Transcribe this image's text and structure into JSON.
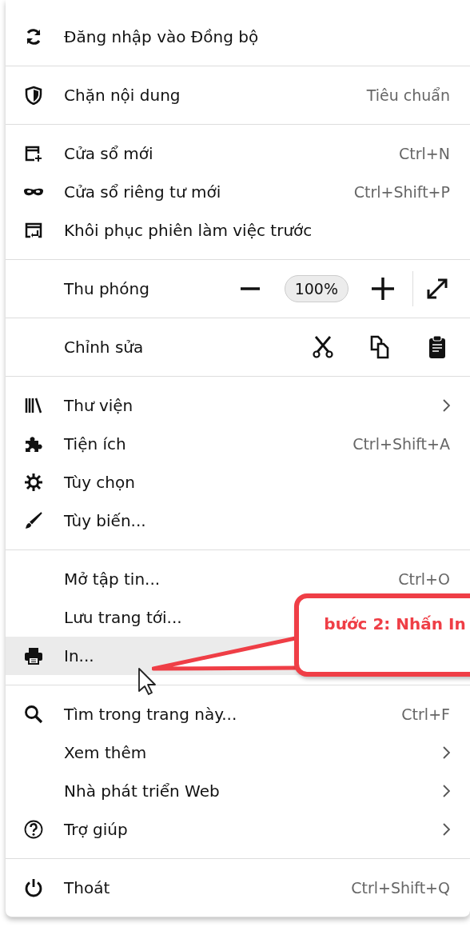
{
  "menu": {
    "sections": [
      {
        "kind": "list",
        "items": [
          {
            "label": "Đăng nhập vào Đồng bộ",
            "highlighted": false
          }
        ]
      },
      {
        "kind": "list",
        "items": [
          {
            "label": "Chặn nội dung",
            "shortcut": "Tiêu chuẩn",
            "highlighted": false
          }
        ]
      },
      {
        "kind": "list",
        "items": [
          {
            "label": "Cửa sổ mới",
            "shortcut": "Ctrl+N",
            "highlighted": false
          },
          {
            "label": "Cửa sổ riêng tư mới",
            "shortcut": "Ctrl+Shift+P",
            "highlighted": false
          },
          {
            "label": "Khôi phục phiên làm việc trước",
            "highlighted": false
          }
        ]
      },
      {
        "kind": "zoom",
        "label": "Thu phóng",
        "value": "100%"
      },
      {
        "kind": "edit",
        "label": "Chỉnh sửa"
      },
      {
        "kind": "list",
        "items": [
          {
            "label": "Thư viện",
            "submenu": true,
            "highlighted": false
          },
          {
            "label": "Tiện ích",
            "shortcut": "Ctrl+Shift+A",
            "highlighted": false
          },
          {
            "label": "Tùy chọn",
            "highlighted": false
          },
          {
            "label": "Tùy biến...",
            "highlighted": false
          }
        ]
      },
      {
        "kind": "list",
        "items": [
          {
            "label": "Mở tập tin...",
            "shortcut": "Ctrl+O",
            "highlighted": false
          },
          {
            "label": "Lưu trang tới...",
            "highlighted": false
          },
          {
            "label": "In...",
            "highlighted": true
          }
        ]
      },
      {
        "kind": "list",
        "items": [
          {
            "label": "Tìm trong trang này...",
            "shortcut": "Ctrl+F",
            "highlighted": false
          },
          {
            "label": "Xem thêm",
            "submenu": true,
            "highlighted": false
          },
          {
            "label": "Nhà phát triển Web",
            "submenu": true,
            "highlighted": false
          },
          {
            "label": "Trợ giúp",
            "submenu": true,
            "highlighted": false
          }
        ]
      },
      {
        "kind": "list",
        "items": [
          {
            "label": "Thoát",
            "shortcut": "Ctrl+Shift+Q",
            "highlighted": false
          }
        ]
      }
    ]
  },
  "callout": {
    "text": "bước 2: Nhấn In"
  }
}
